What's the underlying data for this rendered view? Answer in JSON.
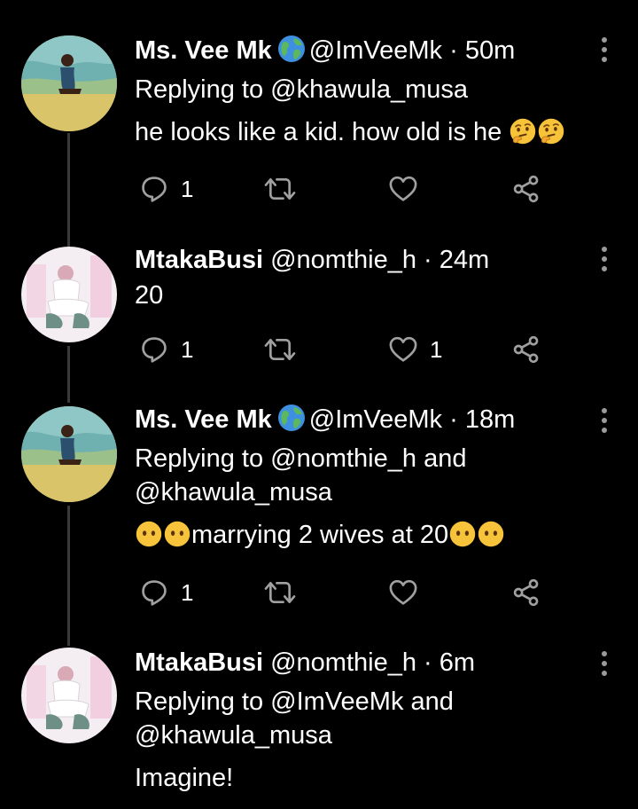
{
  "colors": {
    "background": "#000000",
    "text": "#ffffff",
    "icon": "#a0a0a0",
    "thread_line": "#3a3a3a"
  },
  "tweets": [
    {
      "name": "Ms. Vee Mk",
      "handle": "@ImVeeMk",
      "separator": "·",
      "time": "50m",
      "reply_to_line1": "Replying to @khawula_musa",
      "text": "he looks like a kid. how old is he",
      "reply_count": "1",
      "like_count": ""
    },
    {
      "name": "MtakaBusi",
      "handle": "@nomthie_h",
      "separator": "·",
      "time": "24m",
      "text": "20",
      "reply_count": "1",
      "like_count": "1"
    },
    {
      "name": "Ms. Vee Mk",
      "handle": "@ImVeeMk",
      "separator": "·",
      "time": "18m",
      "reply_to_line1": "Replying to @nomthie_h and",
      "reply_to_line2": "@khawula_musa",
      "text": "marrying 2 wives at 20",
      "reply_count": "1",
      "like_count": ""
    },
    {
      "name": "MtakaBusi",
      "handle": "@nomthie_h",
      "separator": "·",
      "time": "6m",
      "reply_to_line1": "Replying to @ImVeeMk and",
      "reply_to_line2": "@khawula_musa",
      "text": "Imagine!"
    }
  ]
}
